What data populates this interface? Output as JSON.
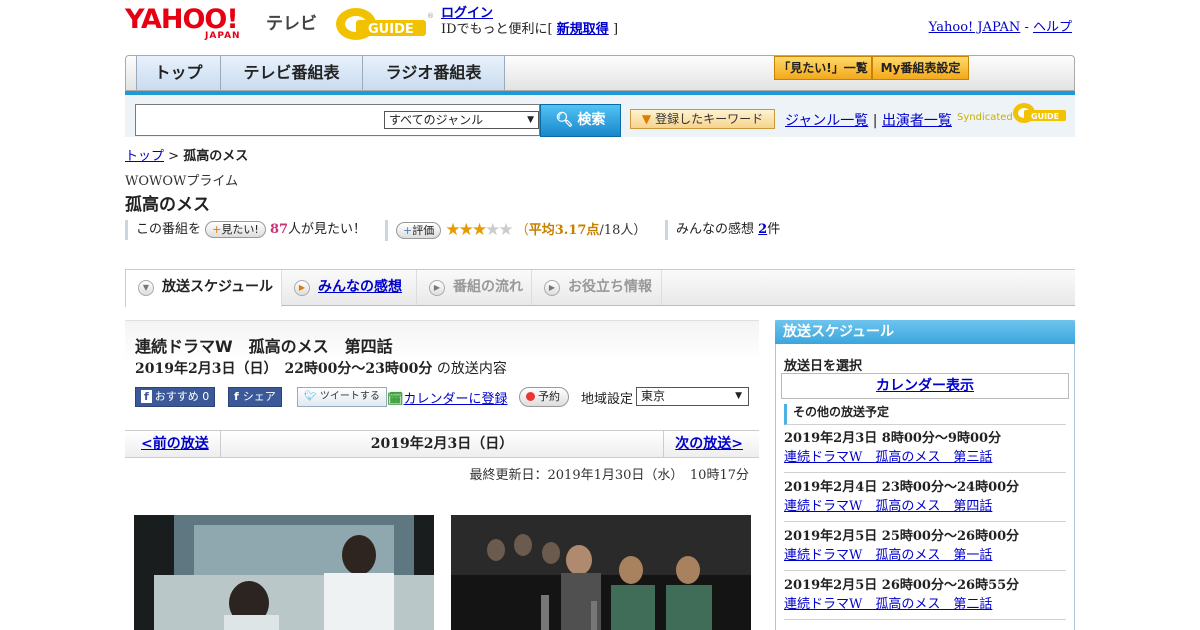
{
  "header": {
    "yahoo_logo": "YAHOO!",
    "japan_logo": "JAPAN",
    "tv_label": "テレビ",
    "guide_logo": "GUIDE",
    "login_link": "ログイン",
    "login_text_before": "IDでもっと便利に[",
    "signup_link": "新規取得",
    "login_text_after": "]",
    "yahoo_japan_link": "Yahoo! JAPAN",
    "separator": "-",
    "help_link": "ヘルプ"
  },
  "nav": {
    "tabs": [
      {
        "label": "トップ"
      },
      {
        "label": "テレビ番組表"
      },
      {
        "label": "ラジオ番組表"
      }
    ],
    "want_list_button": "「見たい!」一覧",
    "my_schedule_button": "My番組表設定"
  },
  "search": {
    "input_value": "",
    "genre_selected": "すべてのジャンル",
    "search_button": "検索",
    "keyword_button": "登録したキーワード",
    "genre_list_link": "ジャンル一覧",
    "link_separator": "|",
    "performer_list_link": "出演者一覧",
    "syndicated_label": "Syndicated",
    "syndicated_logo": "GUIDE"
  },
  "breadcrumb": {
    "home": "トップ",
    "separator": ">",
    "current": "孤高のメス"
  },
  "program": {
    "channel": "WOWOWプライム",
    "title": "孤高のメス",
    "want_prefix": "この番組を",
    "want_button": "見たい!",
    "want_count": "87",
    "want_suffix": "人が見たい！",
    "rate_button": "評価",
    "stars_filled": "★★★",
    "stars_empty": "★★",
    "rating_open": "（",
    "rating_avg_label": "平均",
    "rating_avg_value": "3.17点",
    "rating_count": "/18人）",
    "review_label": "みんなの感想",
    "review_count": "2",
    "review_suffix": "件"
  },
  "subtabs": [
    {
      "label": "放送スケジュール"
    },
    {
      "label": "みんなの感想"
    },
    {
      "label": "番組の流れ"
    },
    {
      "label": "お役立ち情報"
    }
  ],
  "episode": {
    "title": "連続ドラマW　孤高のメス　第四話",
    "date_time": "2019年2月3日（日）　22時00分～23時00分",
    "date_suffix": "の放送内容",
    "fb_recommend": "おすすめ",
    "fb_recommend_count": "0",
    "fb_share": "シェア",
    "tweet": "ツイートする",
    "calendar_link": "カレンダーに登録",
    "record_button": "予約",
    "region_label": "地域設定",
    "region_selected": "東京"
  },
  "pager": {
    "prev": "<前の放送",
    "current": "2019年2月3日（日）",
    "next": "次の放送>"
  },
  "updated": "最終更新日：2019年1月30日（水）　10時17分",
  "sidebar": {
    "header": "放送スケジュール",
    "date_select_label": "放送日を選択",
    "calendar_button": "カレンダー表示",
    "other_heading": "その他の放送予定",
    "items": [
      {
        "time": "2019年2月3日  8時00分～9時00分",
        "title": "連続ドラマW　孤高のメス　第三話"
      },
      {
        "time": "2019年2月4日  23時00分～24時00分",
        "title": "連続ドラマW　孤高のメス　第四話"
      },
      {
        "time": "2019年2月5日  25時00分～26時00分",
        "title": "連続ドラマW　孤高のメス　第一話"
      },
      {
        "time": "2019年2月5日  26時00分～26時55分",
        "title": "連続ドラマW　孤高のメス　第二話"
      }
    ]
  },
  "colors": {
    "yahoo_red": "#e60012",
    "blue_bar": "#1e9bd7",
    "link": "#0000cc",
    "star": "#e89b00"
  }
}
